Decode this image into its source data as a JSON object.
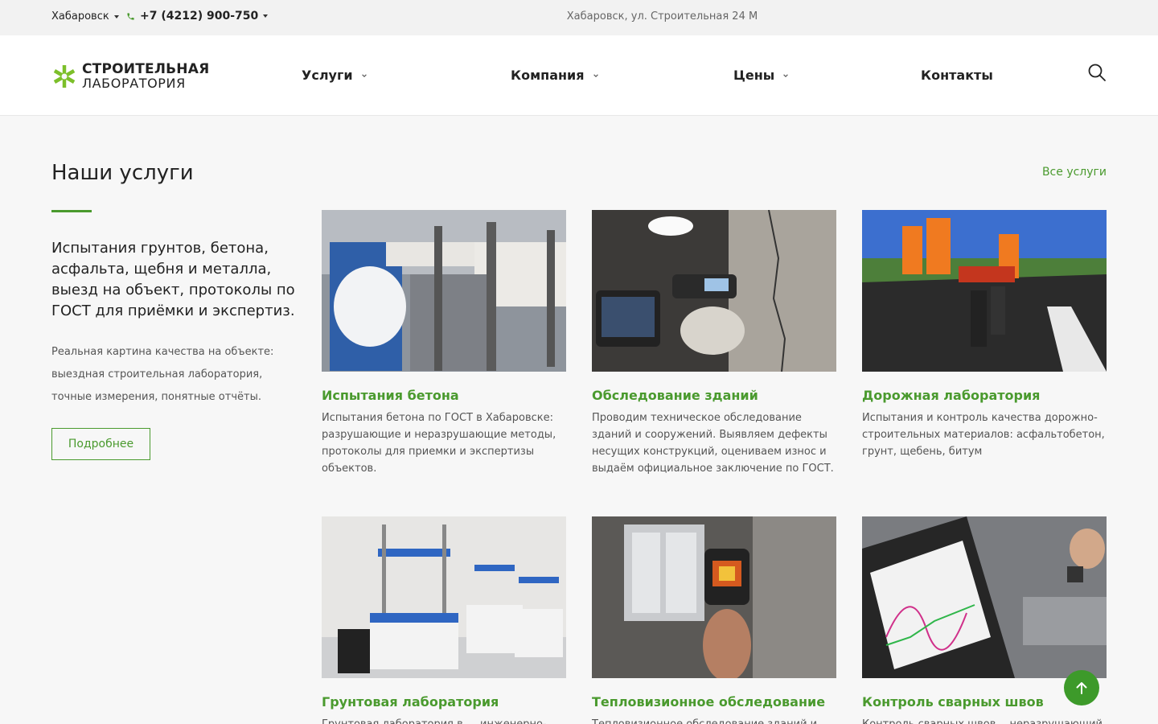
{
  "topbar": {
    "city": "Хабаровск",
    "phone": "+7 (4212) 900-750",
    "address": "Хабаровск, ул. Строительная 24 М"
  },
  "header": {
    "logo_line1": "СТРОИТЕЛЬНАЯ",
    "logo_line2": "ЛАБОРАТОРИЯ",
    "nav": [
      {
        "label": "Услуги"
      },
      {
        "label": "Компания"
      },
      {
        "label": "Цены"
      },
      {
        "label": "Контакты"
      }
    ]
  },
  "services": {
    "title": "Наши услуги",
    "all_link": "Все услуги",
    "lead": "Испытания грунтов, бетона, асфальта, щебня и металла, выезд на объект, протоколы по ГОСТ для приёмки и экспертиз.",
    "description": "Реальная картина качества на объекте: выездная строительная лаборатория, точные измерения, понятные отчёты.",
    "more_button": "Подробнее",
    "cards": [
      {
        "title": "Испытания бетона",
        "text": "Испытания бетона по ГОСТ в Хабаровске: разрушающие и неразрушающие методы, протоколы для приемки и экспертизы объектов."
      },
      {
        "title": "Обследование зданий",
        "text": "Проводим техническое обследование зданий и сооружений. Выявляем дефекты несущих конструкций, оцениваем износ и выдаём официальное заключение по ГОСТ."
      },
      {
        "title": "Дорожная лаборатория",
        "text": "Испытания и контроль качества дорожно-строительных материалов: асфальтобетон, грунт, щебень, битум"
      },
      {
        "title": "Грунтовая лаборатория",
        "text": "Грунтовая лаборатория в — инженерно-"
      },
      {
        "title": "Тепловизионное обследование",
        "text": "Тепловизионное обследование зданий и"
      },
      {
        "title": "Контроль сварных швов",
        "text": "Контроль сварных швов— неразрушающий"
      }
    ]
  },
  "colors": {
    "accent": "#4a9a2e",
    "button_green": "#3d9a2a"
  }
}
